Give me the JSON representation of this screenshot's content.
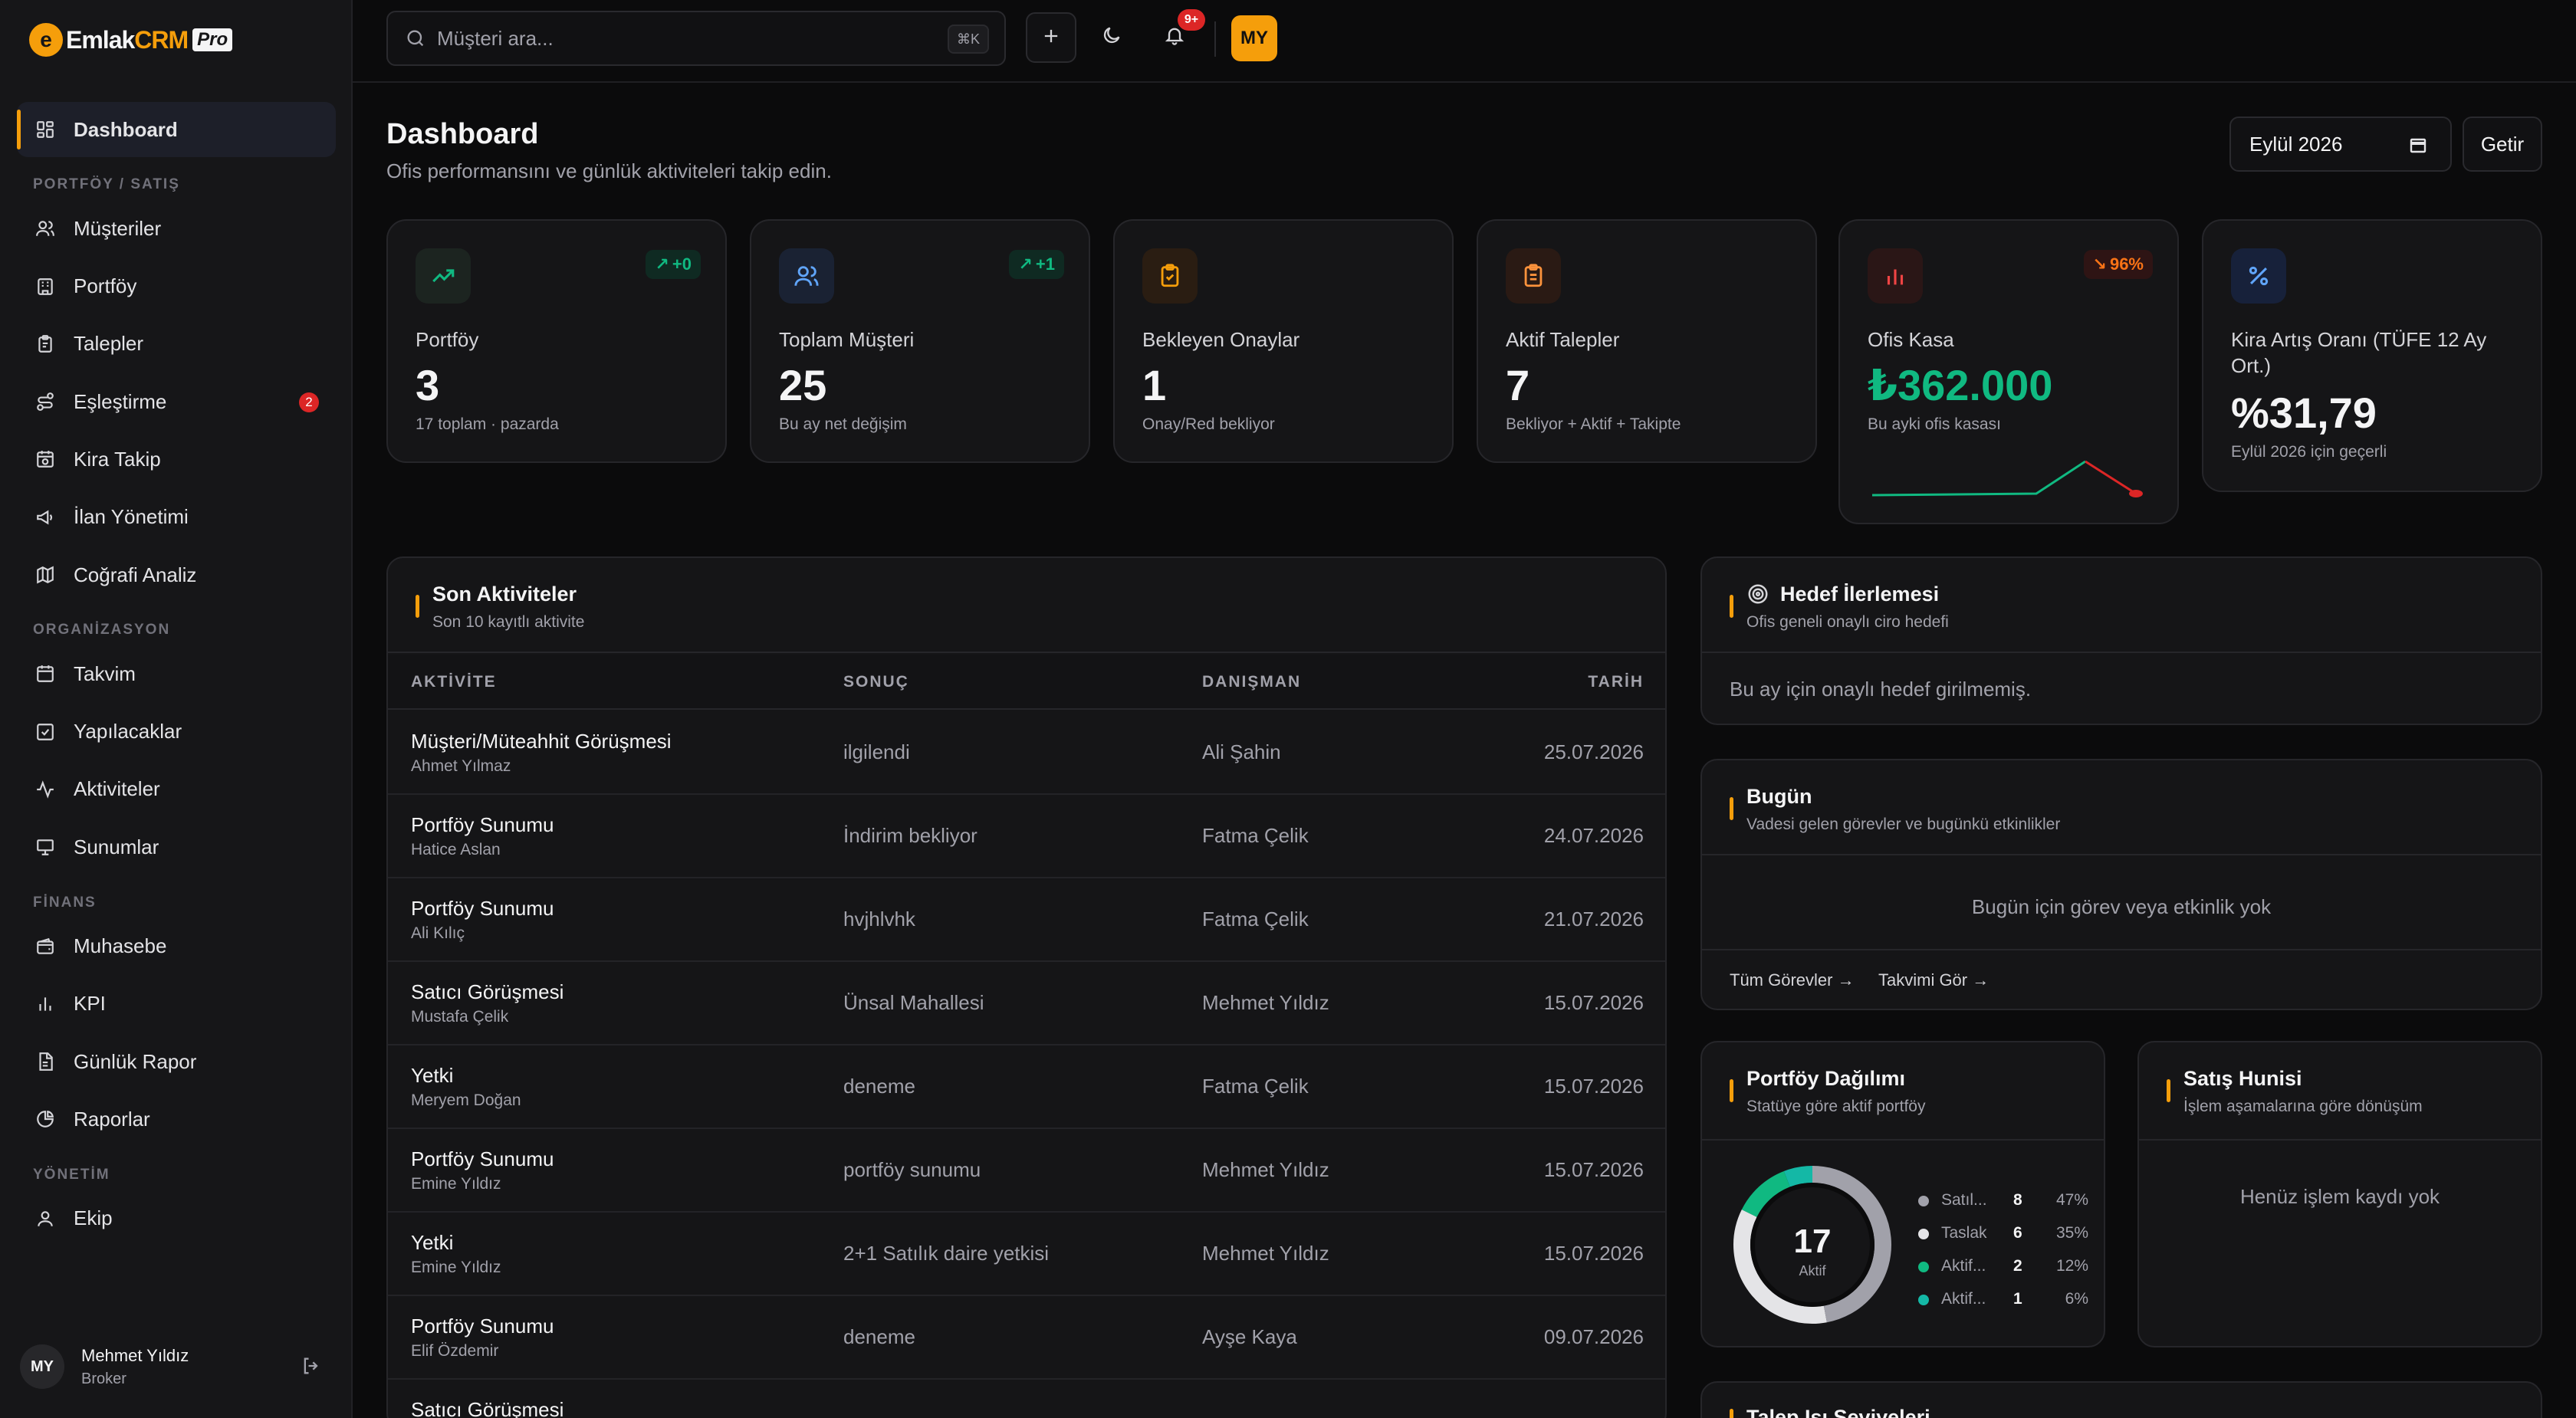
{
  "brand": {
    "name_prefix": "Emlak",
    "name_suffix": "CRM",
    "badge": "Pro",
    "logo_letter": "e"
  },
  "sidebar": {
    "active": "Dashboard",
    "sections": [
      "PORTFÖY / SATIŞ",
      "ORGANİZASYON",
      "FİNANS",
      "YÖNETİM"
    ],
    "items": [
      {
        "label": "Dashboard",
        "icon": "dashboard-icon"
      },
      {
        "label": "Müşteriler",
        "icon": "users-icon"
      },
      {
        "label": "Portföy",
        "icon": "building-icon"
      },
      {
        "label": "Talepler",
        "icon": "clipboard-icon"
      },
      {
        "label": "Eşleştirme",
        "icon": "route-icon",
        "badge": "2"
      },
      {
        "label": "Kira Takip",
        "icon": "calendar-clock-icon"
      },
      {
        "label": "İlan Yönetimi",
        "icon": "megaphone-icon"
      },
      {
        "label": "Coğrafi Analiz",
        "icon": "map-icon"
      },
      {
        "label": "Takvim",
        "icon": "calendar-icon"
      },
      {
        "label": "Yapılacaklar",
        "icon": "checkbox-icon"
      },
      {
        "label": "Aktiviteler",
        "icon": "activity-icon"
      },
      {
        "label": "Sunumlar",
        "icon": "presentation-icon"
      },
      {
        "label": "Muhasebe",
        "icon": "wallet-icon"
      },
      {
        "label": "KPI",
        "icon": "bar-chart-icon"
      },
      {
        "label": "Günlük Rapor",
        "icon": "file-icon"
      },
      {
        "label": "Raporlar",
        "icon": "pie-chart-icon"
      },
      {
        "label": "Ekip",
        "icon": "user-icon"
      }
    ],
    "user": {
      "initials": "MY",
      "name": "Mehmet Yıldız",
      "role": "Broker"
    }
  },
  "topbar": {
    "search_placeholder": "Müşteri ara...",
    "search_shortcut": "⌘K",
    "notification_count": "9+",
    "avatar_initials": "MY"
  },
  "header": {
    "title": "Dashboard",
    "subtitle": "Ofis performansını ve günlük aktiviteleri takip edin.",
    "month_value": "Eylül 2026",
    "fetch_label": "Getir"
  },
  "stats": [
    {
      "label": "Portföy",
      "value": "3",
      "note": "17 toplam · pazarda",
      "delta": "+0",
      "icon": "trending-up-icon"
    },
    {
      "label": "Toplam Müşteri",
      "value": "25",
      "note": "Bu ay net değişim",
      "delta": "+1",
      "icon": "users-icon"
    },
    {
      "label": "Bekleyen Onaylar",
      "value": "1",
      "note": "Onay/Red bekliyor",
      "icon": "clipboard-check-icon"
    },
    {
      "label": "Aktif Talepler",
      "value": "7",
      "note": "Bekliyor + Aktif + Takipte",
      "icon": "clipboard-list-icon"
    },
    {
      "label": "Ofis Kasa",
      "value": "₺362.000",
      "note": "Bu ayki ofis kasası",
      "delta": "96%",
      "icon": "bar-chart-icon"
    },
    {
      "label": "Kira Artış Oranı (TÜFE 12 Ay Ort.)",
      "value": "%31,79",
      "note": "Eylül 2026 için geçerli",
      "icon": "percent-icon"
    }
  ],
  "colors": {
    "accent": "#f59e0b",
    "positive": "#10b981",
    "negative": "#dc2626",
    "sparkline_up": "#10b981",
    "sparkline_down": "#dc2626"
  },
  "activities": {
    "title": "Son Aktiviteler",
    "subtitle": "Son 10 kayıtlı aktivite",
    "columns": [
      "AKTİVİTE",
      "SONUÇ",
      "DANIŞMAN",
      "TARİH"
    ],
    "rows": [
      {
        "activity": "Müşteri/Müteahhit Görüşmesi",
        "person": "Ahmet Yılmaz",
        "result": "ilgilendi",
        "advisor": "Ali Şahin",
        "date": "25.07.2026"
      },
      {
        "activity": "Portföy Sunumu",
        "person": "Hatice Aslan",
        "result": "İndirim bekliyor",
        "advisor": "Fatma Çelik",
        "date": "24.07.2026"
      },
      {
        "activity": "Portföy Sunumu",
        "person": "Ali Kılıç",
        "result": "hvjhlvhk",
        "advisor": "Fatma Çelik",
        "date": "21.07.2026"
      },
      {
        "activity": "Satıcı Görüşmesi",
        "person": "Mustafa Çelik",
        "result": "Ünsal Mahallesi",
        "advisor": "Mehmet Yıldız",
        "date": "15.07.2026"
      },
      {
        "activity": "Yetki",
        "person": "Meryem Doğan",
        "result": "deneme",
        "advisor": "Fatma Çelik",
        "date": "15.07.2026"
      },
      {
        "activity": "Portföy Sunumu",
        "person": "Emine Yıldız",
        "result": "portföy sunumu",
        "advisor": "Mehmet Yıldız",
        "date": "15.07.2026"
      },
      {
        "activity": "Yetki",
        "person": "Emine Yıldız",
        "result": "2+1 Satılık daire yetkisi",
        "advisor": "Mehmet Yıldız",
        "date": "15.07.2026"
      },
      {
        "activity": "Portföy Sunumu",
        "person": "Elif Özdemir",
        "result": "deneme",
        "advisor": "Ayşe Kaya",
        "date": "09.07.2026"
      },
      {
        "activity": "Satıcı Görüşmesi",
        "person": "",
        "result": "",
        "advisor": "",
        "date": ""
      }
    ]
  },
  "goal": {
    "title": "Hedef İlerlemesi",
    "subtitle": "Ofis geneli onaylı ciro hedefi",
    "empty": "Bu ay için onaylı hedef girilmemiş."
  },
  "today": {
    "title": "Bugün",
    "subtitle": "Vadesi gelen görevler ve bugünkü etkinlikler",
    "empty": "Bugün için görev veya etkinlik yok",
    "link_tasks": "Tüm Görevler →",
    "link_calendar": "Takvimi Gör →"
  },
  "portfolio": {
    "title": "Portföy Dağılımı",
    "subtitle": "Statüye göre aktif portföy",
    "center_value": "17",
    "center_label": "Aktif"
  },
  "chart_data": {
    "type": "pie",
    "categories": [
      "Satıl...",
      "Taslak",
      "Aktif...",
      "Aktif..."
    ],
    "values": [
      8,
      6,
      2,
      1
    ],
    "percents": [
      "47%",
      "35%",
      "12%",
      "6%"
    ],
    "colors": [
      "#a1a1aa",
      "#e4e4e7",
      "#10b981",
      "#14b8a6"
    ],
    "title": "Portföy Dağılımı"
  },
  "funnel": {
    "title": "Satış Hunisi",
    "subtitle": "İşlem aşamalarına göre dönüşüm",
    "empty": "Henüz işlem kaydı yok"
  },
  "next_panel": {
    "title": "Talep Isı Seviyeleri"
  }
}
